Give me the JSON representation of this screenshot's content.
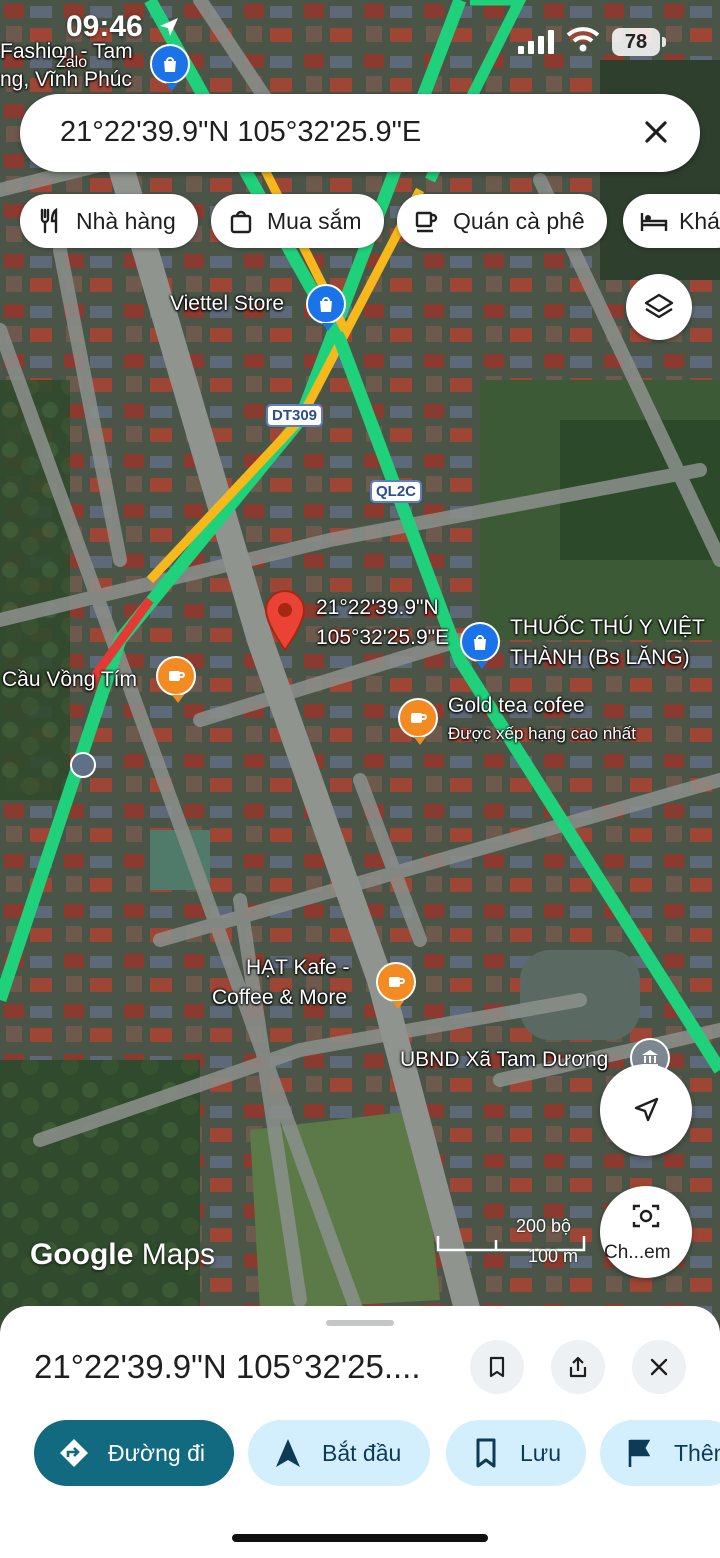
{
  "status": {
    "time": "09:46",
    "battery": "78"
  },
  "search": {
    "query": "21°22'39.9\"N 105°32'25.9\"E"
  },
  "chips": [
    {
      "label": "Nhà hàng",
      "icon": "restaurant-icon"
    },
    {
      "label": "Mua sắm",
      "icon": "shopping-bag-icon"
    },
    {
      "label": "Quán cà phê",
      "icon": "coffee-icon"
    },
    {
      "label": "Khá",
      "icon": "bed-icon"
    }
  ],
  "map": {
    "labels": {
      "top_poi_line1": "Fashion - Tam",
      "top_poi_line2": "ng, Vĩnh Phúc",
      "top_poi_small": "Zalo",
      "viettel": "Viettel Store",
      "dt309": "DT309",
      "ql2c": "QL2C",
      "pin_line1": "21°22'39.9\"N",
      "pin_line2": "105°32'25.9\"E",
      "thuoc_line1": "THUỐC THÚ Y VIỆT",
      "thuoc_line2": "THÀNH (Bs LĂNG)",
      "cau_vong": "Cầu Vồng Tím",
      "gold_tea": "Gold tea cofee",
      "gold_tea_sub": "Được xếp hạng cao nhất",
      "hat_line1": "HẠT Kafe -",
      "hat_line2": "Coffee & More",
      "ubnd": "UBND Xã Tam Dương"
    },
    "scale": {
      "imperial": "200 bộ",
      "metric": "100 m"
    },
    "logo": {
      "google": "Google",
      "maps": "Maps"
    },
    "camera_label": "Ch...em"
  },
  "sheet": {
    "title": "21°22'39.9\"N 105°32'25....",
    "actions": [
      {
        "label": "Đường đi",
        "icon": "directions-icon"
      },
      {
        "label": "Bắt đầu",
        "icon": "navigation-arrow-icon"
      },
      {
        "label": "Lưu",
        "icon": "bookmark-icon"
      },
      {
        "label": "Thêm",
        "icon": "flag-icon"
      }
    ]
  },
  "colors": {
    "traffic_green": "#1fd17a",
    "traffic_yellow": "#f6b81a",
    "traffic_red": "#e53935",
    "pin_red": "#ea4335",
    "primary_button": "#116a7f"
  }
}
